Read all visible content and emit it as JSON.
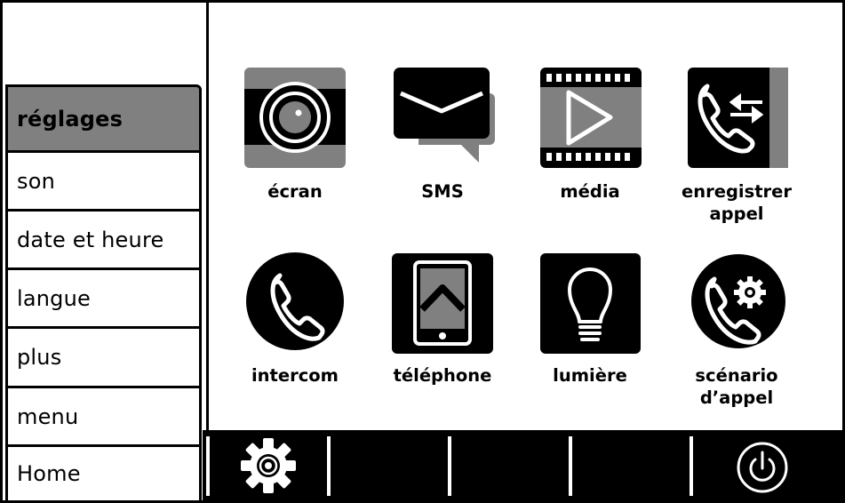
{
  "sidebar": {
    "items": [
      {
        "label": "réglages",
        "active": true
      },
      {
        "label": "son"
      },
      {
        "label": "date et heure"
      },
      {
        "label": "langue"
      },
      {
        "label": "plus"
      },
      {
        "label": "menu"
      },
      {
        "label": "Home"
      }
    ]
  },
  "grid": {
    "apps": [
      {
        "label": "écran",
        "icon": "screen-icon"
      },
      {
        "label": "SMS",
        "icon": "sms-icon"
      },
      {
        "label": "média",
        "icon": "media-icon"
      },
      {
        "label": "enregistrer appel",
        "icon": "record-call-icon"
      },
      {
        "label": "intercom",
        "icon": "intercom-icon"
      },
      {
        "label": "téléphone",
        "icon": "phone-icon"
      },
      {
        "label": "lumière",
        "icon": "light-bulb-icon"
      },
      {
        "label": "scénario d’appel",
        "icon": "call-scenario-icon"
      }
    ]
  },
  "bottom_bar": {
    "icons": [
      "gear-icon",
      "power-icon"
    ]
  },
  "colors": {
    "primary": "#000000",
    "secondary": "#808080",
    "background": "#ffffff"
  }
}
